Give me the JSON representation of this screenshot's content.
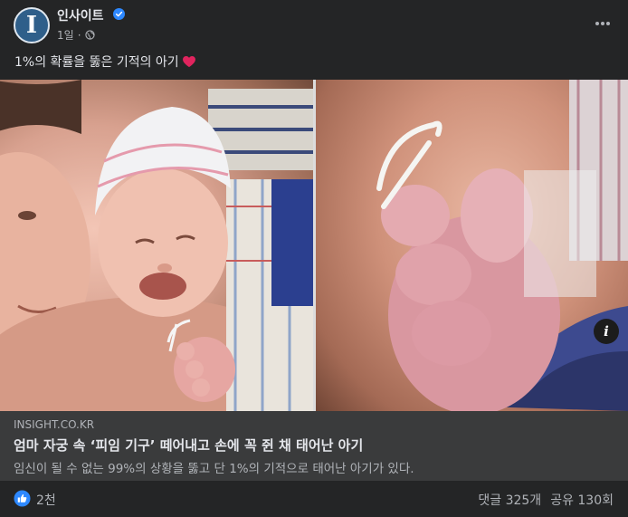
{
  "post": {
    "page_name": "인사이트",
    "time": "1일",
    "avatar_letter": "I",
    "caption": "1%의 확률을 뚫은 기적의 아기",
    "caption_emoji": "heart-icon"
  },
  "link": {
    "domain": "INSIGHT.CO.KR",
    "title": "엄마 자궁 속 ‘피임 기구’ 떼어내고 손에 꼭 쥔 채 태어난 아기",
    "description": "임신이 될 수 없는 99%의 상황을 뚫고 단 1%의 기적으로 태어난 아기가 있다."
  },
  "stats": {
    "reactions": "2천",
    "comments": "댓글 325개",
    "shares": "공유 130회"
  },
  "colors": {
    "background": "#242526",
    "link_preview_bg": "#3a3b3c",
    "verified": "#2d88ff",
    "like": "#2d88ff",
    "heart": "#e0245e"
  },
  "icons": [
    "verified-badge-icon",
    "globe-icon",
    "more-options-icon",
    "heart-icon",
    "info-icon",
    "like-reaction-icon"
  ]
}
